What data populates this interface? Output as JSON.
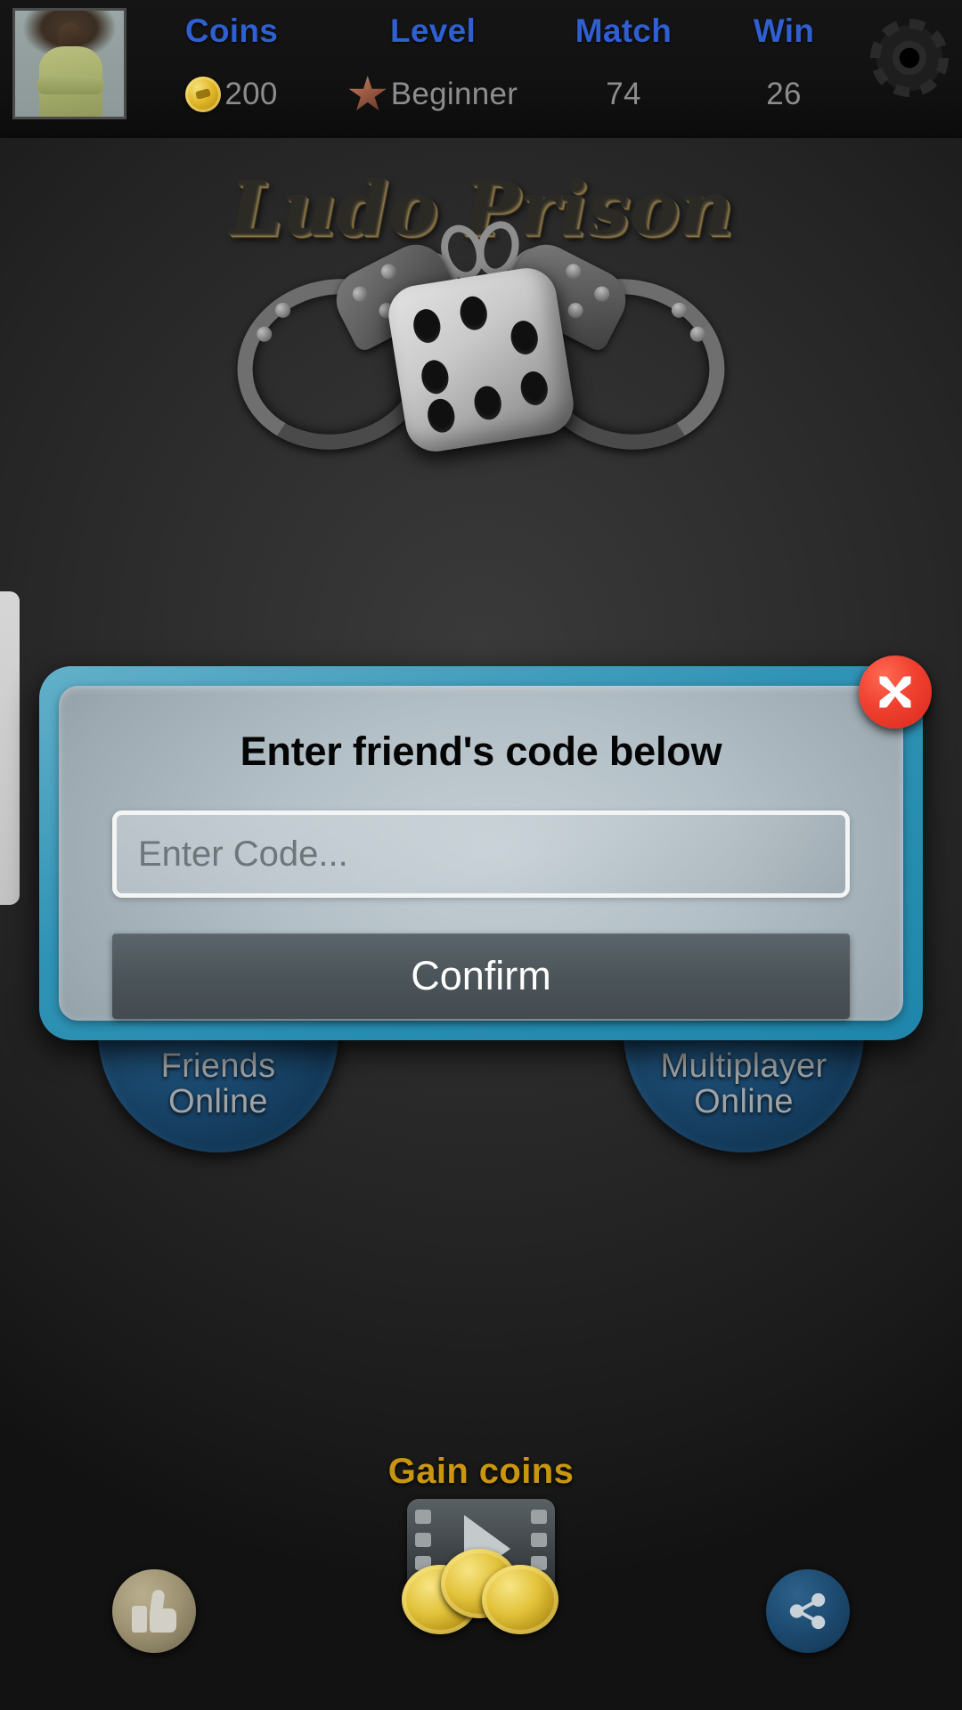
{
  "app": {
    "title": "Ludo Prison"
  },
  "topbar": {
    "avatar_alt": "player-avatar",
    "stats": [
      {
        "key": "coins",
        "label": "Coins",
        "value": "200",
        "icon": "coin-icon"
      },
      {
        "key": "level",
        "label": "Level",
        "value": "Beginner",
        "icon": "star-icon"
      },
      {
        "key": "match",
        "label": "Match",
        "value": "74",
        "icon": ""
      },
      {
        "key": "win",
        "label": "Win",
        "value": "26",
        "icon": ""
      }
    ],
    "settings_icon": "gear-icon",
    "label_color": "#2f5fd0",
    "value_color": "#8d8d8d"
  },
  "menu": {
    "friends_online": "Friends\nOnline",
    "friends_online_line1": "Friends",
    "friends_online_line2": "Online",
    "multiplayer_online_line1": "Multiplayer",
    "multiplayer_online_line2": "Online"
  },
  "gain_coins": {
    "label": "Gain coins",
    "label_color": "#c9960f",
    "icon": "video-play-icon"
  },
  "bottom": {
    "like_icon": "thumbs-up-icon",
    "share_icon": "share-icon"
  },
  "modal": {
    "title": "Enter friend's code below",
    "input_placeholder": "Enter Code...",
    "input_value": "",
    "confirm_label": "Confirm",
    "close_icon": "close-x-icon",
    "border_color": "#2f93b5",
    "close_color": "#f04030"
  }
}
